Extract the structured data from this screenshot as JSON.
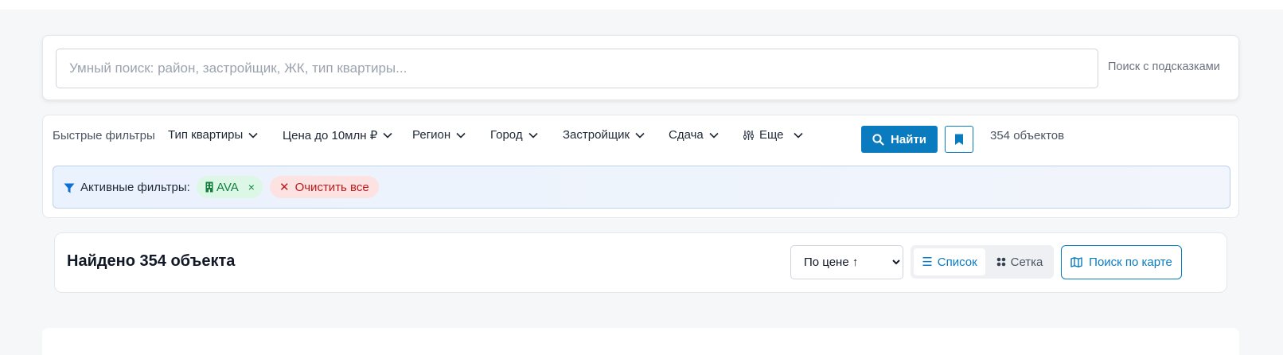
{
  "search": {
    "placeholder": "Умный поиск: район, застройщик, ЖК, тип квартиры...",
    "value": "",
    "hint": "Поиск с подсказками"
  },
  "filters": {
    "label": "Быстрые фильтры",
    "dropdowns": [
      {
        "label": "Тип квартиры"
      },
      {
        "label": "Цена до 10млн ₽"
      },
      {
        "label": "Регион"
      },
      {
        "label": "Город"
      },
      {
        "label": "Застройщик"
      },
      {
        "label": "Сдача"
      },
      {
        "label": "Еще",
        "icon": "sliders-icon"
      }
    ],
    "find_label": "Найти",
    "count": "354 объектов"
  },
  "active_filters": {
    "label": "Активные фильтры:",
    "chips": [
      {
        "label": "AVA",
        "icon": "building-icon",
        "remove": "×"
      }
    ],
    "clear_label": "Очистить все",
    "clear_icon": "✕"
  },
  "results": {
    "title": "Найдено 354 объекта",
    "sort_options": [
      "По цене ↑"
    ],
    "sort_selected": "По цене ↑",
    "view_list": "Список",
    "view_grid": "Сетка",
    "map_button": "Поиск по карте"
  },
  "colors": {
    "accent": "#0b7bbf",
    "chip_green": "#15803d",
    "chip_red": "#b91c1c",
    "background": "#f6f7f9"
  }
}
